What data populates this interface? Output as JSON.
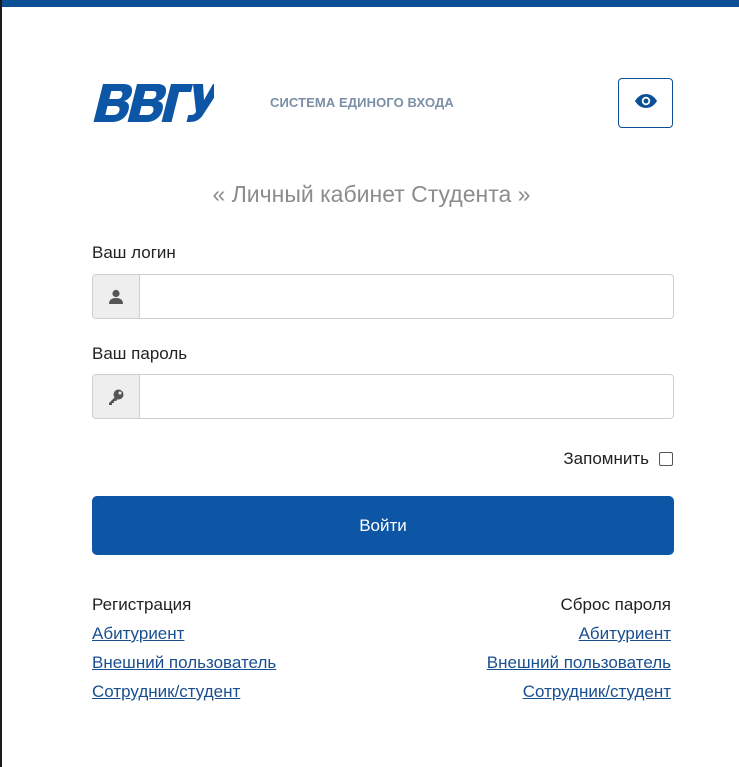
{
  "header": {
    "logo_text": "ВВГУ",
    "system_title": "СИСТЕМА ЕДИНОГО ВХОДА",
    "accent_color": "#0d4f95"
  },
  "accessibility": {
    "icon": "eye-icon"
  },
  "page": {
    "title": "« Личный кабинет Студента »"
  },
  "form": {
    "login_label": "Ваш логин",
    "login_value": "",
    "login_icon": "user-icon",
    "password_label": "Ваш пароль",
    "password_value": "",
    "password_icon": "key-icon",
    "remember_label": "Запомнить",
    "remember_checked": false,
    "submit_label": "Войти",
    "button_color": "#0d56a6"
  },
  "links": {
    "registration": {
      "heading": "Регистрация",
      "items": [
        "Абитуриент",
        "Внешний пользователь",
        "Сотрудник/студент"
      ]
    },
    "reset": {
      "heading": "Сброс пароля",
      "items": [
        "Абитуриент",
        "Внешний пользователь",
        "Сотрудник/студент"
      ]
    }
  }
}
